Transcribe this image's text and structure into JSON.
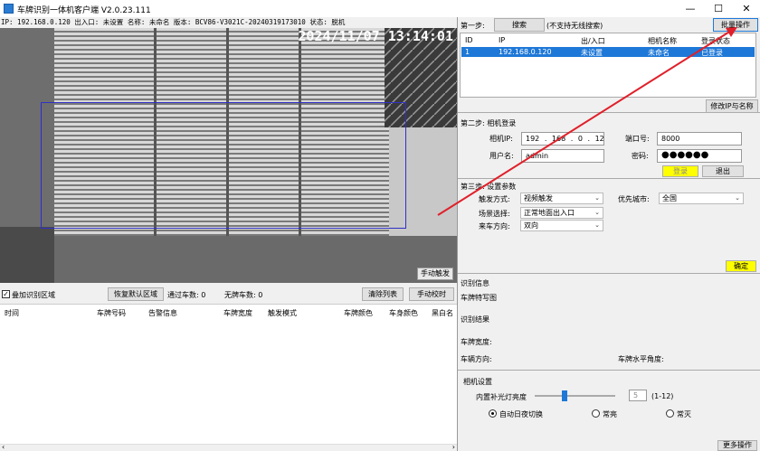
{
  "window": {
    "title": "车牌识别一体机客户端 V2.0.23.111",
    "minimize_icon": "minimize-icon",
    "maximize_icon": "maximize-icon",
    "close_icon": "close-icon"
  },
  "info_bar": "IP: 192.168.0.120 出入口: 未设置 名称: 未命名 版本: BCV86-V3021C-20240319173010 状态: 脱机",
  "video": {
    "timestamp": "2024/11/07 13:14:01",
    "manual_trigger_label": "手动触发"
  },
  "controls": {
    "overlay_roi_label": "叠加识别区域",
    "overlay_roi_checked": true,
    "restore_default_label": "恢复默认区域",
    "pass_count_label": "通过车数: 0",
    "no_plate_count_label": "无牌车数: 0",
    "clear_list_label": "清除列表",
    "manual_calibrate_label": "手动校时"
  },
  "result_table": {
    "columns": [
      "时间",
      "车牌号码",
      "告警信息",
      "车牌宽度",
      "触发模式",
      "车牌颜色",
      "车身颜色",
      "黑白名"
    ]
  },
  "step1": {
    "label": "第一步:",
    "search_button": "搜索",
    "hint": "(不支持无线搜索)",
    "batch_button": "批量操作",
    "columns": [
      "ID",
      "IP",
      "出/入口",
      "相机名称",
      "登录状态"
    ],
    "rows": [
      {
        "id": "1",
        "ip": "192.168.0.120",
        "gate": "未设置",
        "name": "未命名",
        "status": "已登录"
      }
    ],
    "modify_button": "修改IP与名称"
  },
  "step2": {
    "label": "第二步: 相机登录",
    "ip_label": "相机IP:",
    "ip_parts": [
      "192",
      "168",
      "0",
      "120"
    ],
    "port_label": "端口号:",
    "port_value": "8000",
    "user_label": "用户名:",
    "user_value": "admin",
    "password_label": "密码:",
    "password_value": "●●●●●●",
    "login_button": "登录",
    "logout_button": "退出"
  },
  "step3": {
    "label": "第三步: 设置参数",
    "trigger_label": "触发方式:",
    "trigger_value": "视频触发",
    "city_label": "优先城市:",
    "city_value": "全国",
    "scene_label": "场景选择:",
    "scene_value": "正常地面出入口",
    "direction_label": "来车方向:",
    "direction_value": "双向",
    "confirm_button": "确定"
  },
  "recognition": {
    "info_label": "识别信息",
    "plate_image_label": "车牌特写图",
    "result_label": "识别结果",
    "plate_width_label": "车牌宽度:",
    "vehicle_direction_label": "车辆方向:",
    "plate_angle_label": "车牌水平角度:"
  },
  "camera_settings": {
    "label": "相机设置",
    "fill_light_label": "内置补光灯亮度",
    "fill_light_value": "5",
    "fill_light_fraction": 0.36,
    "range_label": "(1-12)",
    "mode_options": [
      "自动日夜切换",
      "常亮",
      "常灭"
    ],
    "mode_selected": 0,
    "more_button": "更多操作"
  },
  "colors": {
    "selection": "#1e78d7",
    "login_button": "#ffff00",
    "confirm_button": "#ffff00",
    "slider_thumb": "#1e78d7",
    "annotation_arrow": "#e0202a",
    "roi_border": "#3030c8"
  }
}
